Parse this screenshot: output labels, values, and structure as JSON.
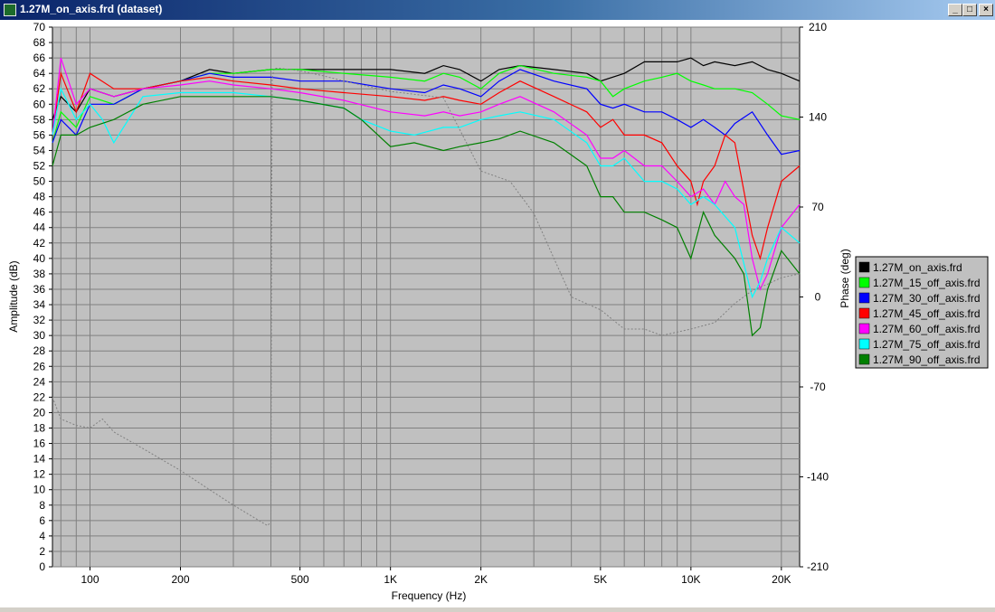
{
  "window": {
    "title": "1.27M_on_axis.frd (dataset)",
    "minimize_glyph": "_",
    "maximize_glyph": "□",
    "close_glyph": "×"
  },
  "chart_data": {
    "type": "line",
    "xlabel": "Frequency (Hz)",
    "ylabel": "Amplitude (dB)",
    "ylabel_right": "Phase (deg)",
    "xscale": "log",
    "xlim": [
      75,
      23000
    ],
    "ylim": [
      0,
      70
    ],
    "ylim_right": [
      -210,
      210
    ],
    "yticks": [
      0,
      2,
      4,
      6,
      8,
      10,
      12,
      14,
      16,
      18,
      20,
      22,
      24,
      26,
      28,
      30,
      32,
      34,
      36,
      38,
      40,
      42,
      44,
      46,
      48,
      50,
      52,
      54,
      56,
      58,
      60,
      62,
      64,
      66,
      68,
      70
    ],
    "yticks_right": [
      -210,
      -140,
      -70,
      0,
      70,
      140,
      210
    ],
    "xtick_labels": [
      {
        "v": 100,
        "label": "100"
      },
      {
        "v": 200,
        "label": "200"
      },
      {
        "v": 500,
        "label": "500"
      },
      {
        "v": 1000,
        "label": "1K"
      },
      {
        "v": 2000,
        "label": "2K"
      },
      {
        "v": 5000,
        "label": "5K"
      },
      {
        "v": 10000,
        "label": "10K"
      },
      {
        "v": 20000,
        "label": "20K"
      }
    ],
    "grid": true,
    "legend_position": "right",
    "series": [
      {
        "name": "1.27M_on_axis.frd",
        "color": "#000000",
        "x": [
          75,
          80,
          90,
          100,
          120,
          150,
          200,
          250,
          300,
          400,
          500,
          700,
          1000,
          1300,
          1500,
          1700,
          2000,
          2300,
          2700,
          3500,
          4500,
          5000,
          6000,
          7000,
          8000,
          9000,
          10000,
          11000,
          12000,
          14000,
          16000,
          18000,
          20000,
          23000
        ],
        "y": [
          58,
          61,
          59,
          62,
          61,
          62,
          63,
          64.5,
          64,
          64.5,
          64.5,
          64.5,
          64.5,
          64,
          65,
          64.5,
          63,
          64.5,
          65,
          64.5,
          64,
          63,
          64,
          65.5,
          65.5,
          65.5,
          66,
          65,
          65.5,
          65,
          65.5,
          64.5,
          64,
          63
        ]
      },
      {
        "name": "1.27M_15_off_axis.frd",
        "color": "#00ff00",
        "x": [
          75,
          80,
          90,
          100,
          120,
          150,
          200,
          250,
          300,
          400,
          500,
          700,
          1000,
          1300,
          1500,
          1700,
          2000,
          2300,
          2700,
          3500,
          4500,
          5000,
          5500,
          6000,
          7000,
          8000,
          9000,
          10000,
          11000,
          12000,
          14000,
          16000,
          18000,
          20000,
          23000
        ],
        "y": [
          55,
          59,
          57,
          61,
          60,
          62,
          63,
          64,
          64,
          64.5,
          64.5,
          64,
          63.5,
          63,
          64,
          63.5,
          62,
          64,
          65,
          64,
          63.5,
          63,
          61,
          62,
          63,
          63.5,
          64,
          63,
          62.5,
          62,
          62,
          61.5,
          60,
          58.5,
          58
        ]
      },
      {
        "name": "1.27M_30_off_axis.frd",
        "color": "#0000ff",
        "x": [
          75,
          80,
          90,
          100,
          120,
          150,
          200,
          250,
          300,
          400,
          500,
          700,
          1000,
          1300,
          1500,
          1700,
          2000,
          2300,
          2700,
          3500,
          4500,
          5000,
          5500,
          6000,
          7000,
          8000,
          9000,
          10000,
          11000,
          12000,
          13000,
          14000,
          16000,
          18000,
          20000,
          23000
        ],
        "y": [
          55,
          58,
          56,
          60,
          60,
          62,
          63,
          64,
          63.5,
          63.5,
          63,
          63,
          62,
          61.5,
          62.5,
          62,
          61,
          63,
          64.5,
          63,
          62,
          60,
          59.5,
          60,
          59,
          59,
          58,
          57,
          58,
          57,
          56,
          57.5,
          59,
          56,
          53.5,
          54
        ]
      },
      {
        "name": "1.27M_45_off_axis.frd",
        "color": "#ff0000",
        "x": [
          75,
          80,
          90,
          100,
          120,
          150,
          200,
          250,
          300,
          400,
          500,
          700,
          1000,
          1300,
          1500,
          1700,
          2000,
          2300,
          2700,
          3500,
          4500,
          5000,
          5500,
          6000,
          7000,
          8000,
          9000,
          10000,
          10500,
          11000,
          12000,
          13000,
          14000,
          16000,
          17000,
          18000,
          20000,
          23000
        ],
        "y": [
          56,
          64,
          59,
          64,
          62,
          62,
          63,
          63.5,
          63,
          62.5,
          62,
          61.5,
          61,
          60.5,
          61,
          60.5,
          60,
          61.5,
          63,
          61,
          59,
          57,
          58,
          56,
          56,
          55,
          52,
          50,
          47,
          50,
          52,
          56,
          55,
          43,
          40,
          44,
          50,
          52
        ]
      },
      {
        "name": "1.27M_60_off_axis.frd",
        "color": "#ff00ff",
        "x": [
          75,
          80,
          90,
          100,
          120,
          150,
          200,
          250,
          300,
          400,
          500,
          700,
          1000,
          1300,
          1500,
          1700,
          2000,
          2300,
          2700,
          3500,
          4500,
          5000,
          5500,
          6000,
          7000,
          8000,
          9000,
          10000,
          11000,
          12000,
          13000,
          14000,
          15000,
          16000,
          17000,
          18000,
          20000,
          23000
        ],
        "y": [
          56,
          66,
          60,
          62,
          61,
          62,
          62.5,
          63,
          62.5,
          62,
          61.5,
          60.5,
          59,
          58.5,
          59,
          58.5,
          59,
          60,
          61,
          59,
          56,
          53,
          53,
          54,
          52,
          52,
          50,
          48,
          49,
          47,
          50,
          48,
          47,
          40,
          36,
          38,
          44,
          47
        ]
      },
      {
        "name": "1.27M_75_off_axis.frd",
        "color": "#00ffff",
        "x": [
          75,
          80,
          90,
          100,
          110,
          120,
          150,
          200,
          250,
          300,
          400,
          500,
          700,
          800,
          1000,
          1200,
          1500,
          1700,
          2000,
          2300,
          2700,
          3500,
          4500,
          5000,
          5500,
          6000,
          7000,
          8000,
          9000,
          10000,
          11000,
          12000,
          14000,
          16000,
          17000,
          18000,
          20000,
          23000
        ],
        "y": [
          56,
          62,
          58,
          60,
          58,
          55,
          61,
          61.5,
          61.5,
          61.5,
          61,
          60.5,
          59.5,
          58,
          56.5,
          56,
          57,
          57,
          58,
          58.5,
          59,
          58,
          55,
          52,
          52,
          53,
          50,
          50,
          49,
          47,
          48,
          47,
          44,
          35,
          37,
          40,
          44,
          42
        ]
      },
      {
        "name": "1.27M_90_off_axis.frd",
        "color": "#008000",
        "x": [
          75,
          80,
          90,
          100,
          120,
          150,
          200,
          250,
          300,
          400,
          500,
          700,
          800,
          1000,
          1200,
          1500,
          1700,
          2000,
          2300,
          2700,
          3500,
          4500,
          5000,
          5500,
          6000,
          7000,
          8000,
          9000,
          10000,
          11000,
          12000,
          14000,
          15000,
          16000,
          17000,
          18000,
          20000,
          23000
        ],
        "y": [
          52,
          56,
          56,
          57,
          58,
          60,
          61,
          61,
          61,
          61,
          60.5,
          59.5,
          58,
          54.5,
          55,
          54,
          54.5,
          55,
          55.5,
          56.5,
          55,
          52,
          48,
          48,
          46,
          46,
          45,
          44,
          40,
          46,
          43,
          40,
          38,
          30,
          31,
          36,
          41,
          38
        ]
      },
      {
        "name": "phase",
        "color": "#808080",
        "dashed": true,
        "axis": "right",
        "x": [
          75,
          80,
          90,
          100,
          110,
          120,
          150,
          200,
          250,
          300,
          390,
          400,
          402,
          404,
          410,
          430,
          500,
          600,
          700,
          1000,
          1500,
          2000,
          2500,
          3000,
          3500,
          4000,
          5000,
          6000,
          7000,
          8000,
          10000,
          12000,
          14000,
          16000,
          18000,
          20000,
          23000
        ],
        "y": [
          -78,
          -95,
          -100,
          -102,
          -95,
          -105,
          -118,
          -135,
          -150,
          -162,
          -178,
          -175,
          40,
          170,
          178,
          178,
          176,
          172,
          168,
          160,
          155,
          98,
          90,
          65,
          30,
          0,
          -10,
          -25,
          -25,
          -30,
          -25,
          -20,
          -5,
          5,
          10,
          15,
          18
        ]
      }
    ]
  }
}
